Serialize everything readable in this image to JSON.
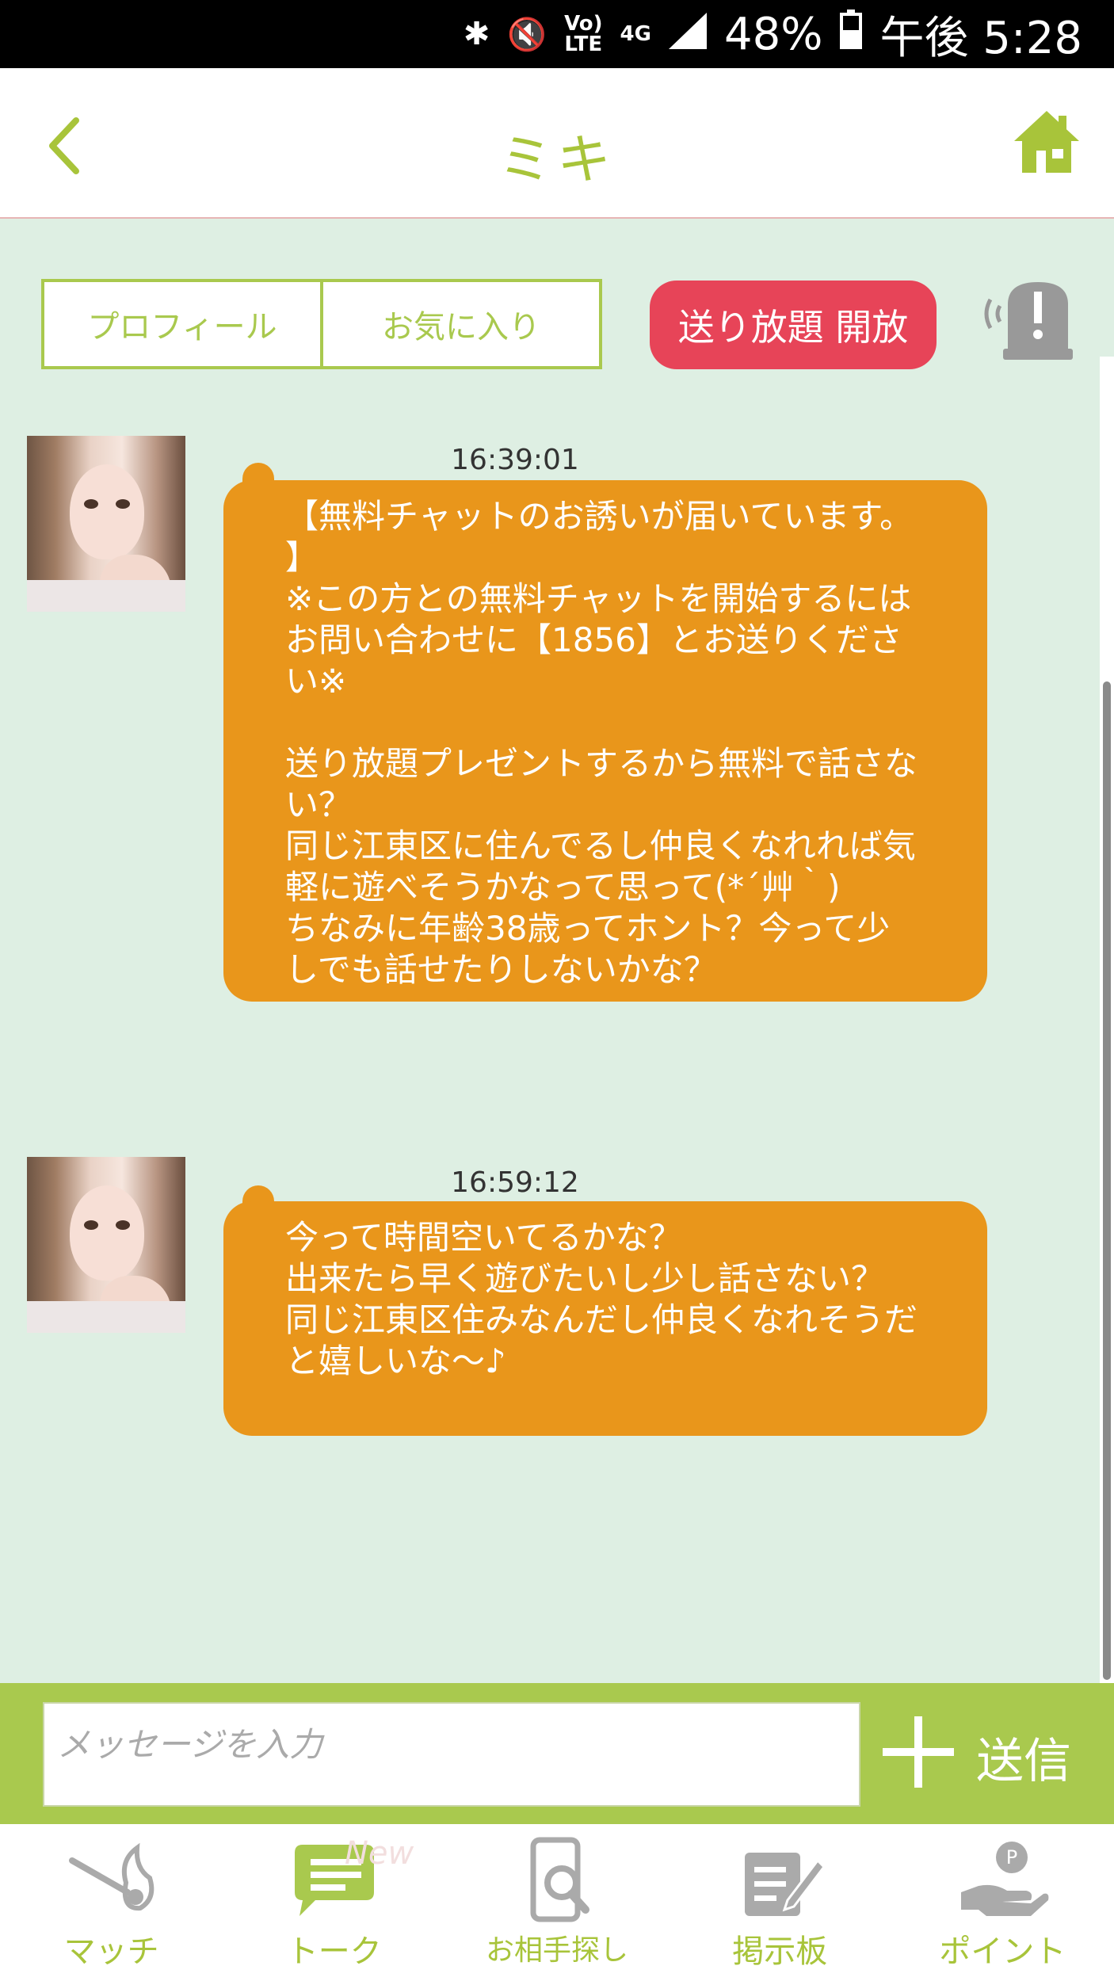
{
  "status_bar": {
    "volte_label": "Vo)\nLTE",
    "network_label": "4G",
    "battery": "48%",
    "time": "午後 5:28"
  },
  "header": {
    "title": "ミキ"
  },
  "actions": {
    "profile_label": "プロフィール",
    "favorite_label": "お気に入り",
    "free_send_label": "送り放題 開放"
  },
  "messages": [
    {
      "time": "16:39:01",
      "text": "【無料チャットのお誘いが届いています。\n】\n※この方との無料チャットを開始するには\nお問い合わせに【1856】とお送りくださ\nい※\n\n送り放題プレゼントするから無料で話さな\nい？\n同じ江東区に住んでるし仲良くなれれば気\n軽に遊べそうかなって思って(*´艸｀)\nちなみに年齢38歳ってホント？今って少\nしでも話せたりしないかな？"
    },
    {
      "time": "16:59:12",
      "text": "今って時間空いてるかな？\n出来たら早く遊びたいし少し話さない？\n同じ江東区住みなんだし仲良くなれそうだ\nと嬉しいな～♪"
    }
  ],
  "input": {
    "placeholder": "メッセージを入力",
    "send_label": "送信"
  },
  "nav": {
    "items": [
      {
        "label": "マッチ",
        "icon": "match-icon"
      },
      {
        "label": "トーク",
        "icon": "talk-icon"
      },
      {
        "label": "お相手探し",
        "icon": "search-phone-icon"
      },
      {
        "label": "掲示板",
        "icon": "board-icon"
      },
      {
        "label": "ポイント",
        "icon": "point-icon"
      }
    ],
    "new_badge": "New"
  },
  "colors": {
    "accent_green": "#a9c94e",
    "bubble_orange": "#e9961b",
    "free_button_red": "#e74458",
    "chat_background": "#deefe3"
  }
}
